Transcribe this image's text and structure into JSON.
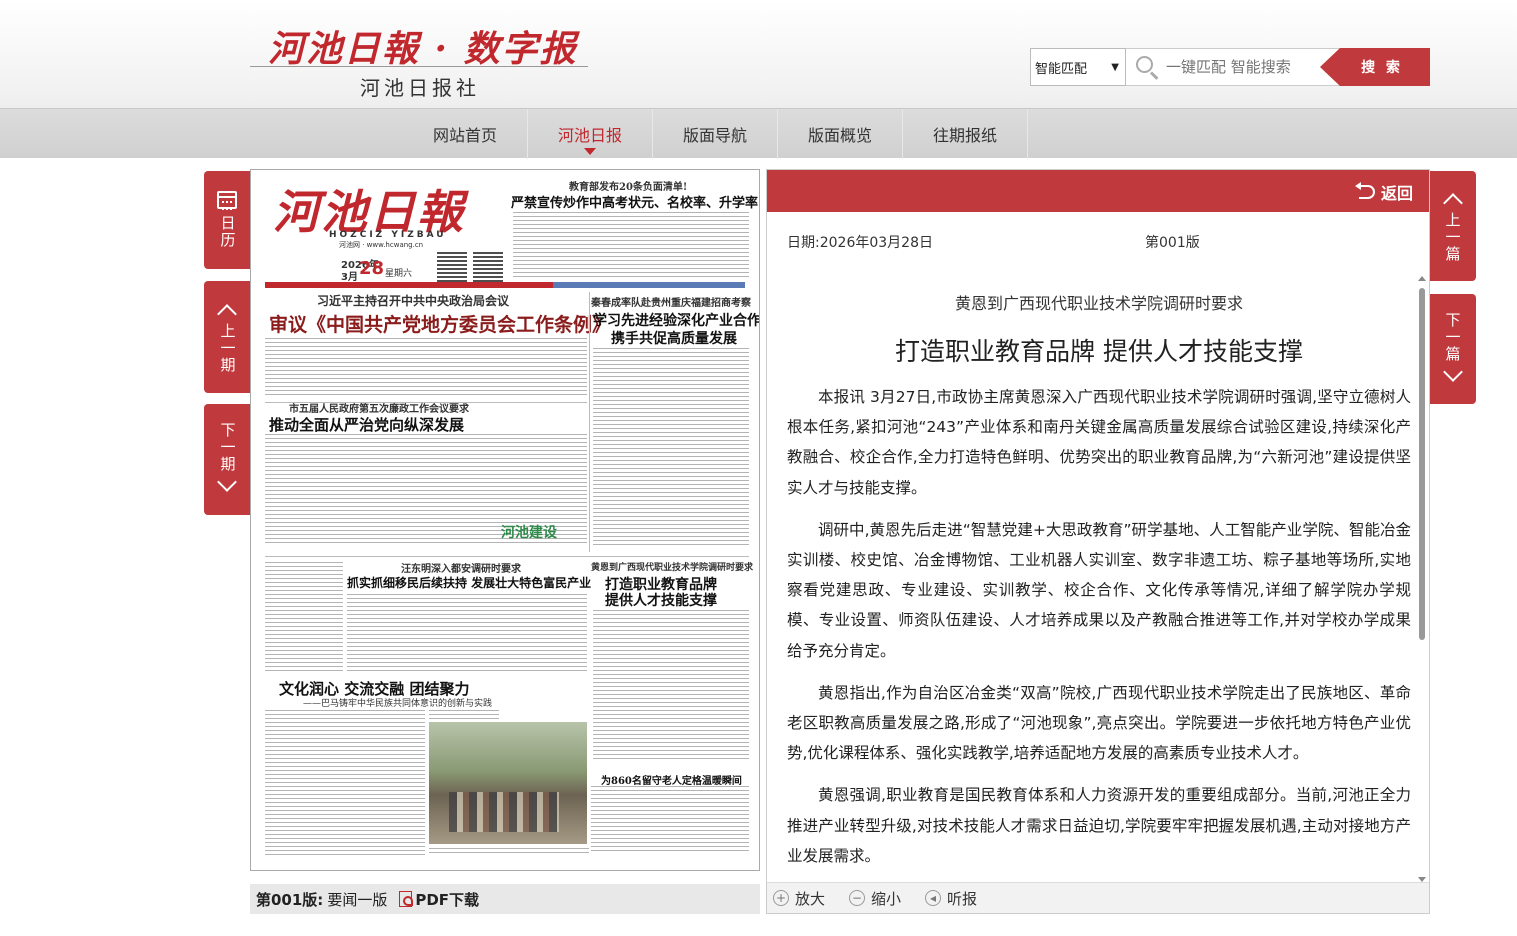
{
  "header": {
    "logo_title": "河池日報 · 数字报",
    "logo_sub": "河池日报社",
    "search_select_value": "智能匹配",
    "search_placeholder": "一键匹配 智能搜索",
    "search_button": "搜 索"
  },
  "nav": {
    "items": [
      "网站首页",
      "河池日报",
      "版面导航",
      "版面概览",
      "往期报纸"
    ],
    "active_index": 1
  },
  "left_tabs": {
    "calendar": "日历",
    "prev_issue": "上一期",
    "next_issue": "下一期"
  },
  "right_tabs": {
    "prev_article": "上一篇",
    "next_article": "下一篇"
  },
  "newspaper": {
    "masthead": "河池日報",
    "pinyin": "HOZCIZ YIZBAU",
    "site": "河池网 · www.hcwang.cn",
    "date_year": "2026年",
    "date_month": "3月",
    "date_day": "28",
    "weekday": "星期六",
    "headlines": {
      "top_kicker": "教育部发布20条负面清单!",
      "top_title": "严禁宣传炒作中高考状元、名校率、升学率",
      "lead_kicker": "习近平主持召开中共中央政治局会议",
      "lead_title": "审议《中国共产党地方委员会工作条例》",
      "right_kicker": "秦春成率队赴贵州重庆福建招商考察",
      "right_title_1": "学习先进经验深化产业合作",
      "right_title_2": "携手共促高质量发展",
      "mid_kicker": "市五届人民政府第五次廉政工作会议要求",
      "mid_title": "推动全面从严治党向纵深发展",
      "badge": "河池建设",
      "low_kicker": "汪东明深入都安调研时要求",
      "low_title": "抓实抓细移民后续扶持 发展壮大特色富民产业",
      "art_kicker": "黄恩到广西现代职业技术学院调研时要求",
      "art_title_1": "打造职业教育品牌",
      "art_title_2": "提供人才技能支撑",
      "culture_title": "文化润心 交流交融 团结聚力",
      "culture_sub": "——巴马铸牢中华民族共同体意识的创新与实践",
      "photo_caption": "为860名留守老人定格温暖瞬间"
    }
  },
  "paper_footer": {
    "edition": "第001版:",
    "section": "要闻一版",
    "pdf": "PDF下载"
  },
  "article": {
    "back": "返回",
    "date": "日期:2026年03月28日",
    "page": "第001版",
    "subtitle": "黄恩到广西现代职业技术学院调研时要求",
    "title": "打造职业教育品牌 提供人才技能支撑",
    "paragraphs": [
      "本报讯 3月27日,市政协主席黄恩深入广西现代职业技术学院调研时强调,坚守立德树人根本任务,紧扣河池“243”产业体系和南丹关键金属高质量发展综合试验区建设,持续深化产教融合、校企合作,全力打造特色鲜明、优势突出的职业教育品牌,为“六新河池”建设提供坚实人才与技能支撑。",
      "调研中,黄恩先后走进“智慧党建+大思政教育”研学基地、人工智能产业学院、智能冶金实训楼、校史馆、冶金博物馆、工业机器人实训室、数字非遗工坊、粽子基地等场所,实地察看党建思政、专业建设、实训教学、校企合作、文化传承等情况,详细了解学院办学规模、专业设置、师资队伍建设、人才培养成果以及产教融合推进等工作,并对学校办学成果给予充分肯定。",
      "黄恩指出,作为自治区冶金类“双高”院校,广西现代职业技术学院走出了民族地区、革命老区职教高质量发展之路,形成了“河池现象”,亮点突出。学院要进一步依托地方特色产业优势,优化课程体系、强化实践教学,培养适配地方发展的高素质专业技术人才。",
      "黄恩强调,职业教育是国民教育体系和人力资源开发的重要组成部分。当前,河池正全力推进产业转型升级,对技术技能人才需求日益迫切,学院要牢牢把握发展机遇,主动对接地方产业发展需求。"
    ],
    "tools": [
      "放大",
      "缩小",
      "听报"
    ]
  }
}
